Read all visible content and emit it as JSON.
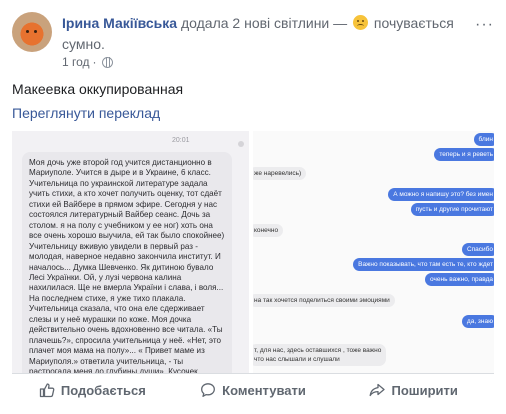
{
  "post": {
    "author": "Ірина Макіївська",
    "action_text": " додала 2 нові світлини — ",
    "feeling_text": " почувається сумно.",
    "time": "1 год",
    "separator": "·",
    "text": "Макеевка оккупированная",
    "translate_link": "Переглянути переклад",
    "more": "···"
  },
  "image_left": {
    "timestamp": "20:01",
    "message": "Моя дочь уже второй год учится дистанционно в Мариуполе. Учится в дыре и в Украине, 6 класс. Учительница по украинской литературе задала учить стихи, а кто хочет получить оценку, тот сдаёт стихи ей Вайбере в прямом эфире. Сегодня у нас состоялся литературный Вайбер сеанс. Дочь за столом. я на полу с учебником у ее ног) хоть она все очень хорошо выучила, ей так было спокойнее) Учительницу вживую увидели в первый раз - молодая, наверное недавно закончила институт. И началось... Думка Шевченко. Як дитиною бувало Лесі Українки. Ой, у лузі червона калина нахилилася. Ще не вмерла України і слава, і воля... На последнем стихе, я уже тихо плакала. Учительница сказала, что она еле сдерживает слезы и у неё мурашки по коже. Моя дочка действительно очень вдохновенно все читала. «Ты плачешь?», спросила учительница у неё. «Нет, это плачет моя мама на полу»... « Привет маме из Мариуполя.» ответила учительница, - ты растрогала меня до глубины души». Кусочек Украины в отдельно взятой квартире оккупированного Донбасса. Вайбер..."
  },
  "image_right": {
    "messages": [
      {
        "text": "блин",
        "dir": "out"
      },
      {
        "text": "теперь и я реветь",
        "dir": "out"
      },
      {
        "text": "же наревелись)",
        "dir": "in"
      },
      {
        "text": "А можно я напишу это? без имен",
        "dir": "out"
      },
      {
        "text": "пусть и другие прочитают",
        "dir": "out"
      },
      {
        "text": "конечно",
        "dir": "in"
      },
      {
        "text": "Спасибо",
        "dir": "out"
      },
      {
        "text": "Важно показывать, что там есть те, кто ждет",
        "dir": "out"
      },
      {
        "text": "очень важно, правда",
        "dir": "out"
      },
      {
        "text": "на так хочется поделиться своими эмоциями",
        "dir": "in"
      },
      {
        "text": "да, знаю",
        "dir": "out"
      },
      {
        "text": "т, для нас, здесь оставшихся , тоже важно\nчто нас слышали и слушали",
        "dir": "in"
      }
    ]
  },
  "footer": {
    "like": "Подобається",
    "comment": "Коментувати",
    "share": "Поширити"
  },
  "colors": {
    "link": "#385898",
    "secondary_text": "#616770",
    "viber_out": "#4a78e0"
  }
}
